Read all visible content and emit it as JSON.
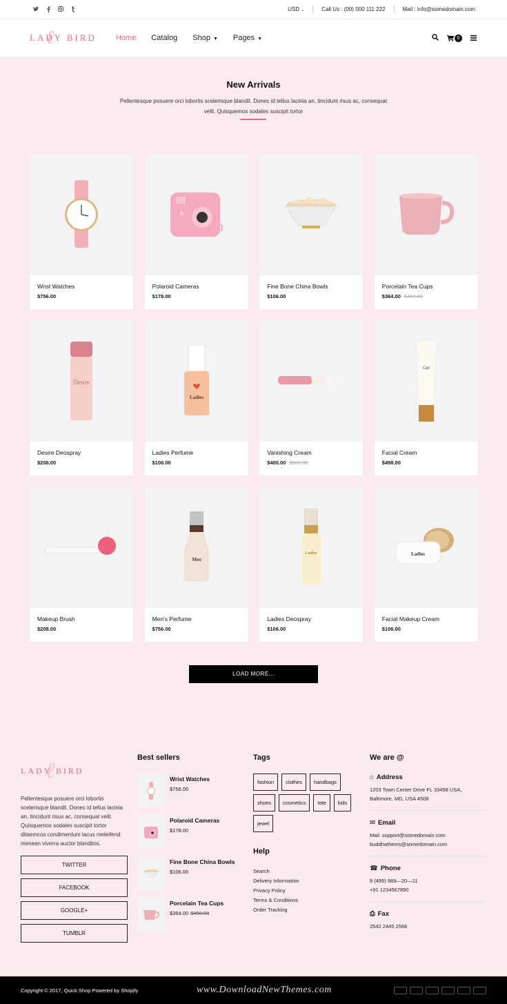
{
  "topbar": {
    "currency": "USD",
    "call": "Call Us : (00) 000 111 222",
    "mail": "Mail : info@somedomain.com"
  },
  "brand": "LADY BIRD",
  "nav": {
    "items": [
      {
        "label": "Home",
        "active": true
      },
      {
        "label": "Catalog"
      },
      {
        "label": "Shop",
        "has_dropdown": true
      },
      {
        "label": "Pages",
        "has_dropdown": true
      }
    ],
    "cart_count": "0"
  },
  "section": {
    "title": "New Arrivals",
    "subtitle": "Pellentesque posuere orci lobortis scelerisque blandit. Donec id tellus lacinia an, tincidunt risus ac, consequat velit. Quisquemos sodales suscipit tortor"
  },
  "products": [
    {
      "name": "Wrist Watches",
      "price": "$756.00",
      "old_price": ""
    },
    {
      "name": "Polaroid Cameras",
      "price": "$178.00",
      "old_price": ""
    },
    {
      "name": "Fine Bone China Bowls",
      "price": "$106.00",
      "old_price": ""
    },
    {
      "name": "Porcelain Tea Cups",
      "price": "$364.00",
      "old_price": "$450.00"
    },
    {
      "name": "Desire Deospray",
      "price": "$208.00",
      "old_price": ""
    },
    {
      "name": "Ladies Perfume",
      "price": "$106.00",
      "old_price": ""
    },
    {
      "name": "Vanishing Cream",
      "price": "$400.00",
      "old_price": "$500.00"
    },
    {
      "name": "Facial Cream",
      "price": "$498.00",
      "old_price": ""
    },
    {
      "name": "Makeup Brush",
      "price": "$208.00",
      "old_price": ""
    },
    {
      "name": "Men's Perfume",
      "price": "$756.00",
      "old_price": ""
    },
    {
      "name": "Ladies Deospray",
      "price": "$106.00",
      "old_price": ""
    },
    {
      "name": "Facial Makeup Cream",
      "price": "$106.00",
      "old_price": ""
    }
  ],
  "load_more": "LOAD MORE...",
  "footer": {
    "about": "Pellentesque posuere orci lobortis scelerisque blandit. Donec id tellus lacinia an, tincidunt risus ac, consequat velit. Quisquemos sodales suscipit tortor ditaemcos condimentum lacus meleifend menean viverra auctor blanditos.",
    "social": [
      "TWITTER",
      "FACEBOOK",
      "GOOGLE+",
      "TUMBLR"
    ],
    "best_sellers_title": "Best sellers",
    "best_sellers": [
      {
        "name": "Wrist Watches",
        "price": "$756.00",
        "old_price": ""
      },
      {
        "name": "Polaroid Cameras",
        "price": "$178.00",
        "old_price": ""
      },
      {
        "name": "Fine Bone China Bowls",
        "price": "$106.00",
        "old_price": ""
      },
      {
        "name": "Porcelain Tea Cups",
        "price": "$364.00",
        "old_price": "$450.00"
      }
    ],
    "tags_title": "Tags",
    "tags": [
      "fashion",
      "clothes",
      "handbags",
      "shoes",
      "cosmetics",
      "tote",
      "kids",
      "jewel"
    ],
    "help_title": "Help",
    "help_links": [
      "Search",
      "Delivery Information",
      "Privacy Policy",
      "Terms & Conditions",
      "Order Tracking"
    ],
    "contact_title": "We are @",
    "address_label": "Address",
    "address": "1203 Town Center Drive FL 33458 USA, Baltimore, MD, USA 4508",
    "email_label": "Email",
    "email_1": "Mail: support@somedomain.com",
    "email_2": "buddhathems@somedomain.com",
    "phone_label": "Phone",
    "phone_1": "8 (495) 989—20—11",
    "phone_2": "+91 1234567890",
    "fax_label": "Fax",
    "fax": "2542 2445 2566"
  },
  "bottom": {
    "copyright": "Copyright © 2017, Quick Shop Powered by Shopify",
    "watermark": "www.DownloadNewThemes.com",
    "payments": [
      "paypal",
      "visa",
      "mastercard",
      "amex",
      "discover",
      "skrill"
    ]
  }
}
